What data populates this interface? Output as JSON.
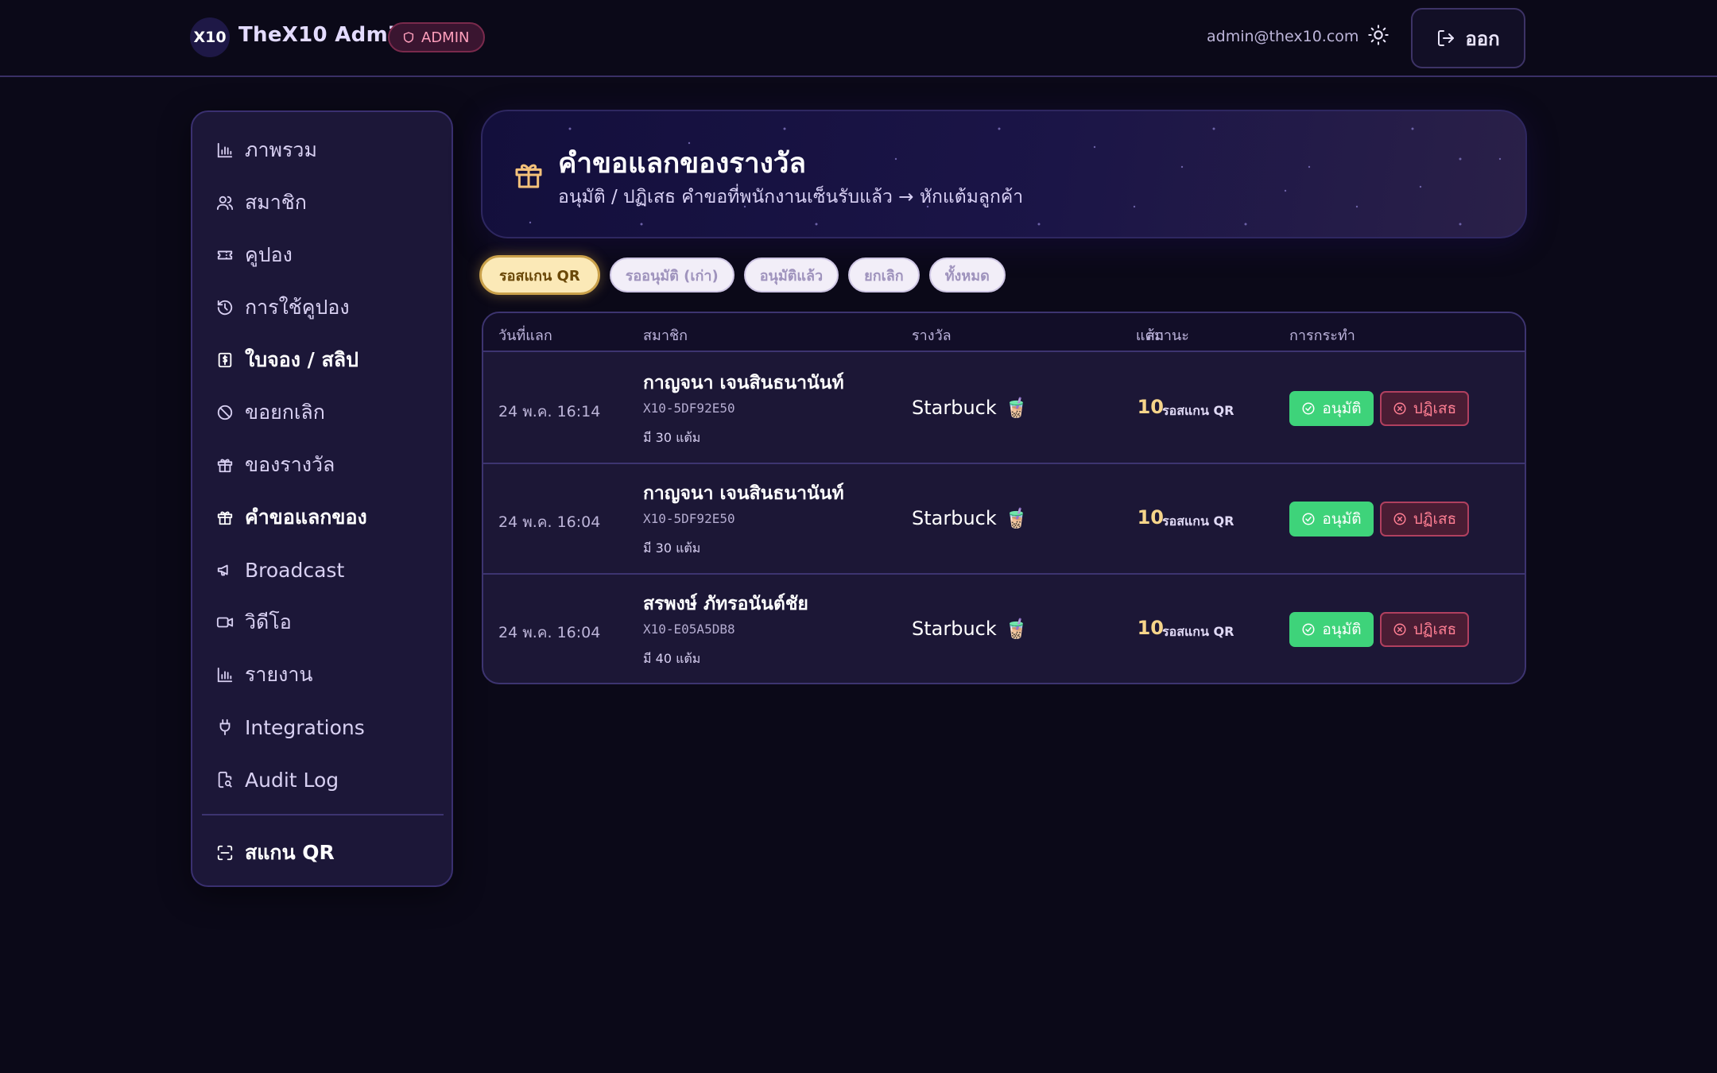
{
  "header": {
    "logo_text": "X10",
    "app_title": "TheX10 Admin",
    "role_badge": "ADMIN",
    "user_email": "admin@thex10.com",
    "logout_label": "ออก"
  },
  "sidebar": {
    "items": [
      {
        "label": "ภาพรวม",
        "icon": "chart-bar-icon"
      },
      {
        "label": "สมาชิก",
        "icon": "users-icon"
      },
      {
        "label": "คูปอง",
        "icon": "ticket-icon"
      },
      {
        "label": "การใช้คูปอง",
        "icon": "history-icon"
      },
      {
        "label": "ใบจอง / สลิป",
        "icon": "receipt-icon"
      },
      {
        "label": "ขอยกเลิก",
        "icon": "ban-icon"
      },
      {
        "label": "ของรางวัล",
        "icon": "gift-icon"
      },
      {
        "label": "คำขอแลกของ",
        "icon": "gift-icon",
        "active": true
      },
      {
        "label": "Broadcast",
        "icon": "megaphone-icon"
      },
      {
        "label": "วิดีโอ",
        "icon": "video-icon"
      },
      {
        "label": "รายงาน",
        "icon": "chart-bar-icon"
      },
      {
        "label": "Integrations",
        "icon": "plug-icon"
      },
      {
        "label": "Audit Log",
        "icon": "file-search-icon"
      }
    ],
    "scan_label": "สแกน QR"
  },
  "hero": {
    "title": "คำขอแลกของรางวัล",
    "subtitle": "อนุมัติ / ปฏิเสธ คำขอที่พนักงานเซ็นรับแล้ว → หักแต้มลูกค้า"
  },
  "filters": [
    {
      "label": "รอสแกน QR",
      "active": true
    },
    {
      "label": "รออนุมัติ (เก่า)"
    },
    {
      "label": "อนุมัติแล้ว"
    },
    {
      "label": "ยกเลิก"
    },
    {
      "label": "ทั้งหมด"
    }
  ],
  "table": {
    "columns": [
      "วันที่แลก",
      "สมาชิก",
      "รางวัล",
      "แต้ม",
      "สถานะ",
      "การกระทำ"
    ],
    "rows": [
      {
        "date": "24 พ.ค. 16:14",
        "name": "กาญจนา เจนสินธนานันท์",
        "code": "X10-5DF92E50",
        "points_have": "มี 30 แต้ม",
        "reward": "Starbuck",
        "reward_emoji": "🧋",
        "points": "10",
        "status": "รอสแกน QR",
        "approve": "อนุมัติ",
        "reject": "ปฏิเสธ"
      },
      {
        "date": "24 พ.ค. 16:04",
        "name": "กาญจนา เจนสินธนานันท์",
        "code": "X10-5DF92E50",
        "points_have": "มี 30 แต้ม",
        "reward": "Starbuck",
        "reward_emoji": "🧋",
        "points": "10",
        "status": "รอสแกน QR",
        "approve": "อนุมัติ",
        "reject": "ปฏิเสธ"
      },
      {
        "date": "24 พ.ค. 16:04",
        "name": "สรพงษ์ ภัทรอนันต์ชัย",
        "code": "X10-E05A5DB8",
        "points_have": "มี 40 แต้ม",
        "reward": "Starbuck",
        "reward_emoji": "🧋",
        "points": "10",
        "status": "รอสแกน QR",
        "approve": "อนุมัติ",
        "reject": "ปฏิเสธ"
      }
    ]
  },
  "colors": {
    "background": "#0b0918",
    "accent_gold": "#f6d58a",
    "approve_green": "#3ed37a",
    "reject_red": "#ff7f93"
  }
}
